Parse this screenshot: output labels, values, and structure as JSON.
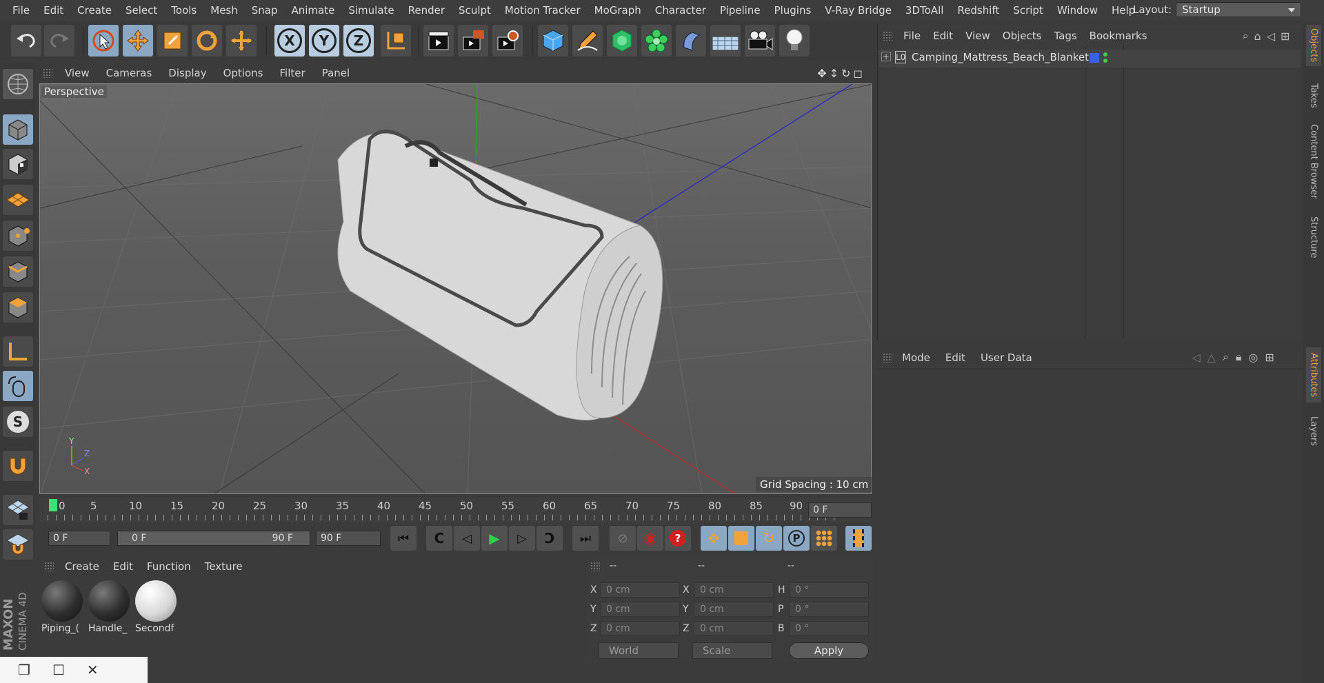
{
  "menubar": {
    "items": [
      "File",
      "Edit",
      "Create",
      "Select",
      "Tools",
      "Mesh",
      "Snap",
      "Animate",
      "Simulate",
      "Render",
      "Sculpt",
      "Motion Tracker",
      "MoGraph",
      "Character",
      "Pipeline",
      "Plugins",
      "V-Ray Bridge",
      "3DToAll",
      "Redshift",
      "Script",
      "Window",
      "Help"
    ],
    "layout_label": "Layout:",
    "layout_value": "Startup"
  },
  "toolbar": {
    "axis_x": "X",
    "axis_y": "Y",
    "axis_z": "Z"
  },
  "viewport": {
    "menu": [
      "View",
      "Cameras",
      "Display",
      "Options",
      "Filter",
      "Panel"
    ],
    "label": "Perspective",
    "grid_spacing": "Grid Spacing : 10 cm",
    "axis_y": "Y",
    "axis_z": "Z",
    "axis_x": "X"
  },
  "timeline": {
    "ticks": [
      "0",
      "5",
      "10",
      "15",
      "20",
      "25",
      "30",
      "35",
      "40",
      "45",
      "50",
      "55",
      "60",
      "65",
      "70",
      "75",
      "80",
      "85",
      "90"
    ],
    "current_frame": "0 F",
    "start_field": "0 F",
    "range_start": "0 F",
    "range_end": "90 F",
    "end_field": "90 F"
  },
  "materials": {
    "menu": [
      "Create",
      "Edit",
      "Function",
      "Texture"
    ],
    "items": [
      {
        "label": "Piping_(",
        "color": "#2e2e2e"
      },
      {
        "label": "Handle_",
        "color": "#2e2e2e"
      },
      {
        "label": "Secondf",
        "color": "#e0e0e0"
      }
    ]
  },
  "coords": {
    "headers": [
      "--",
      "--",
      "--"
    ],
    "rows": [
      {
        "l1": "X",
        "v1": "0 cm",
        "l2": "X",
        "v2": "0 cm",
        "l3": "H",
        "v3": "0 °"
      },
      {
        "l1": "Y",
        "v1": "0 cm",
        "l2": "Y",
        "v2": "0 cm",
        "l3": "P",
        "v3": "0 °"
      },
      {
        "l1": "Z",
        "v1": "0 cm",
        "l2": "Z",
        "v2": "0 cm",
        "l3": "B",
        "v3": "0 °"
      }
    ],
    "world": "World",
    "scale": "Scale",
    "apply": "Apply"
  },
  "brand": {
    "line1": "MAXON",
    "line2": "CINEMA 4D"
  },
  "objects": {
    "menu": [
      "File",
      "Edit",
      "View",
      "Objects",
      "Tags",
      "Bookmarks"
    ],
    "row_name": "Camping_Mattress_Beach_Blanket",
    "layer_color": "#3a5fe0"
  },
  "attributes": {
    "menu": [
      "Mode",
      "Edit",
      "User Data"
    ]
  },
  "sidetabs": {
    "objects": "Objects",
    "takes": "Takes",
    "content_browser": "Content Browser",
    "structure": "Structure",
    "attributes": "Attributes",
    "layers": "Layers"
  },
  "colors": {
    "accent": "#8aa7c4",
    "orange": "#f2a23a",
    "play_green": "#2fd04a",
    "record_red": "#d02020"
  }
}
